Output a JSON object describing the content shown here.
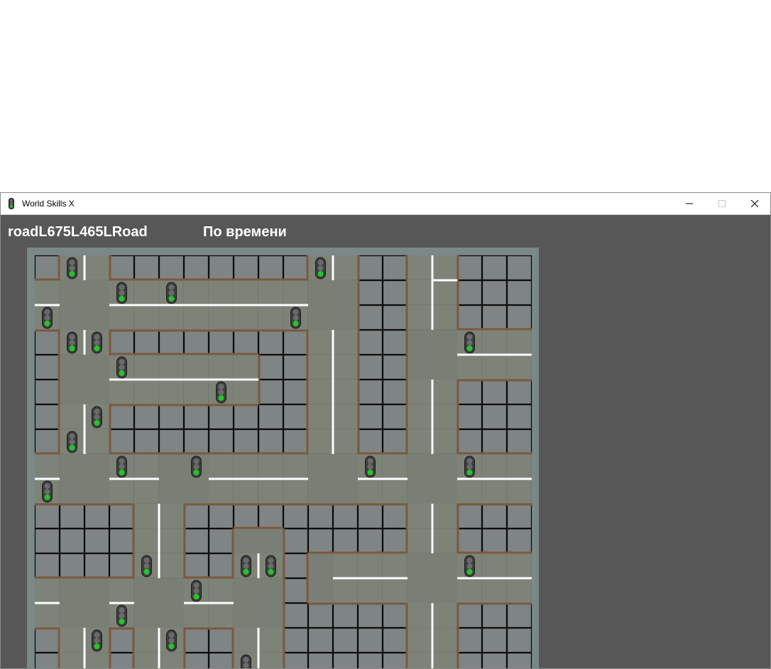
{
  "window": {
    "title": "World Skills X",
    "controls": {
      "minimize": "minimize-icon",
      "maximize": "maximize-icon",
      "close": "close-icon"
    }
  },
  "header": {
    "road_id": "roadL675L465LRoad",
    "mode": "По времени"
  },
  "colors": {
    "window_bg": "#575757",
    "board_bg": "#7b8888",
    "road": "#7e8378",
    "intersection": "#797f74",
    "building": "#7f8485",
    "curb": "#7b5a40",
    "marking": "#ffffff",
    "signal_green": "#22c62a"
  },
  "map": {
    "legend": {
      "B": "building block",
      "R": "road",
      "I": "intersection"
    },
    "rows": [
      "BRRBBBBBBBBRRBBRRBBB",
      "RIIRRRRRRRRIIBBRRBBB",
      "RIIRRRRRRRRIIBBRRBBB",
      "BRRBBBBBBBBRRBBIIRRR",
      "BIIRRRRRRBBRRBBIIRRR",
      "BIIRRRRRRBBRRBBRRBBB",
      "BRRBBBBBBBBRRBBRRBBB",
      "BRRBBBBBBBBRRBBRRBBB",
      "RIIRRIIRRRRIIRRIIRRR",
      "RIIRRIIRRRRIIRRIIRRR",
      "BBBBRRBBBBBBBBBRRBBB",
      "BBBBRRBBIIBBBBBRRBBB",
      "BBBBRRBBRRBIRRRIIRRR",
      "RIIRIIRRIIBIRRRIIRRR",
      "RIIRIIRRIIBBBBBRRBBB",
      "BRRBRRBBRRBBBBBRRBBB",
      "BRRBRRBBRRBBBBBRRBBB"
    ],
    "signals": [
      [
        0,
        1
      ],
      [
        0,
        11
      ],
      [
        1,
        3
      ],
      [
        1,
        5
      ],
      [
        2,
        0
      ],
      [
        2,
        10
      ],
      [
        3,
        1
      ],
      [
        3,
        2
      ],
      [
        3,
        17
      ],
      [
        4,
        3
      ],
      [
        5,
        7
      ],
      [
        6,
        2
      ],
      [
        7,
        1
      ],
      [
        8,
        3
      ],
      [
        8,
        6
      ],
      [
        8,
        13
      ],
      [
        8,
        17
      ],
      [
        9,
        0
      ],
      [
        12,
        4
      ],
      [
        12,
        8
      ],
      [
        12,
        9
      ],
      [
        12,
        17
      ],
      [
        13,
        6
      ],
      [
        14,
        3
      ],
      [
        15,
        2
      ],
      [
        15,
        5
      ],
      [
        16,
        8
      ]
    ]
  }
}
